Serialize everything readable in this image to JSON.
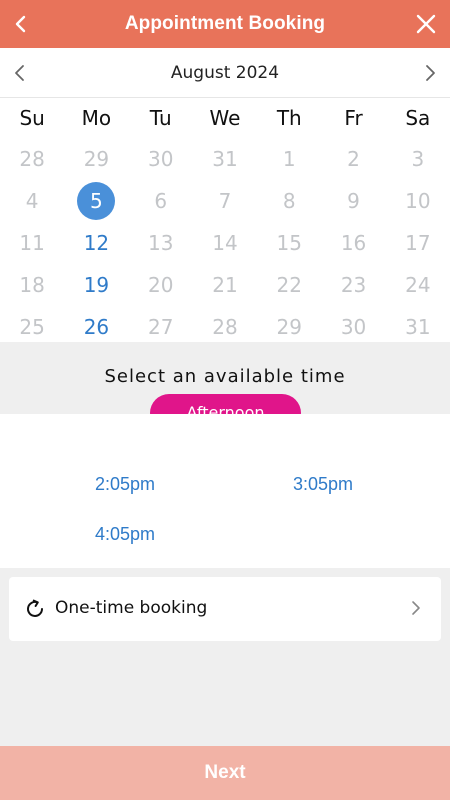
{
  "header": {
    "title": "Appointment Booking"
  },
  "calendar": {
    "month_label": "August 2024",
    "weekdays": [
      "Su",
      "Mo",
      "Tu",
      "We",
      "Th",
      "Fr",
      "Sa"
    ],
    "weeks": [
      [
        "28",
        "29",
        "30",
        "31",
        "1",
        "2",
        "3"
      ],
      [
        "4",
        "5",
        "6",
        "7",
        "8",
        "9",
        "10"
      ],
      [
        "11",
        "12",
        "13",
        "14",
        "15",
        "16",
        "17"
      ],
      [
        "18",
        "19",
        "20",
        "21",
        "22",
        "23",
        "24"
      ],
      [
        "25",
        "26",
        "27",
        "28",
        "29",
        "30",
        "31"
      ]
    ],
    "selected_date": "5",
    "available_dates": [
      "5",
      "12",
      "19",
      "26"
    ]
  },
  "time_section": {
    "label": "Select an available time",
    "period": "Afternoon",
    "slots": [
      "2:05pm",
      "3:05pm",
      "4:05pm"
    ]
  },
  "booking_type": {
    "label": "One-time booking"
  },
  "footer": {
    "next_label": "Next"
  },
  "colors": {
    "header": "#e8735a",
    "accent_blue": "#2f7bc9",
    "selected_circle": "#4a90d9",
    "period_pill": "#e0158a",
    "next_button": "#f2b3a6"
  }
}
